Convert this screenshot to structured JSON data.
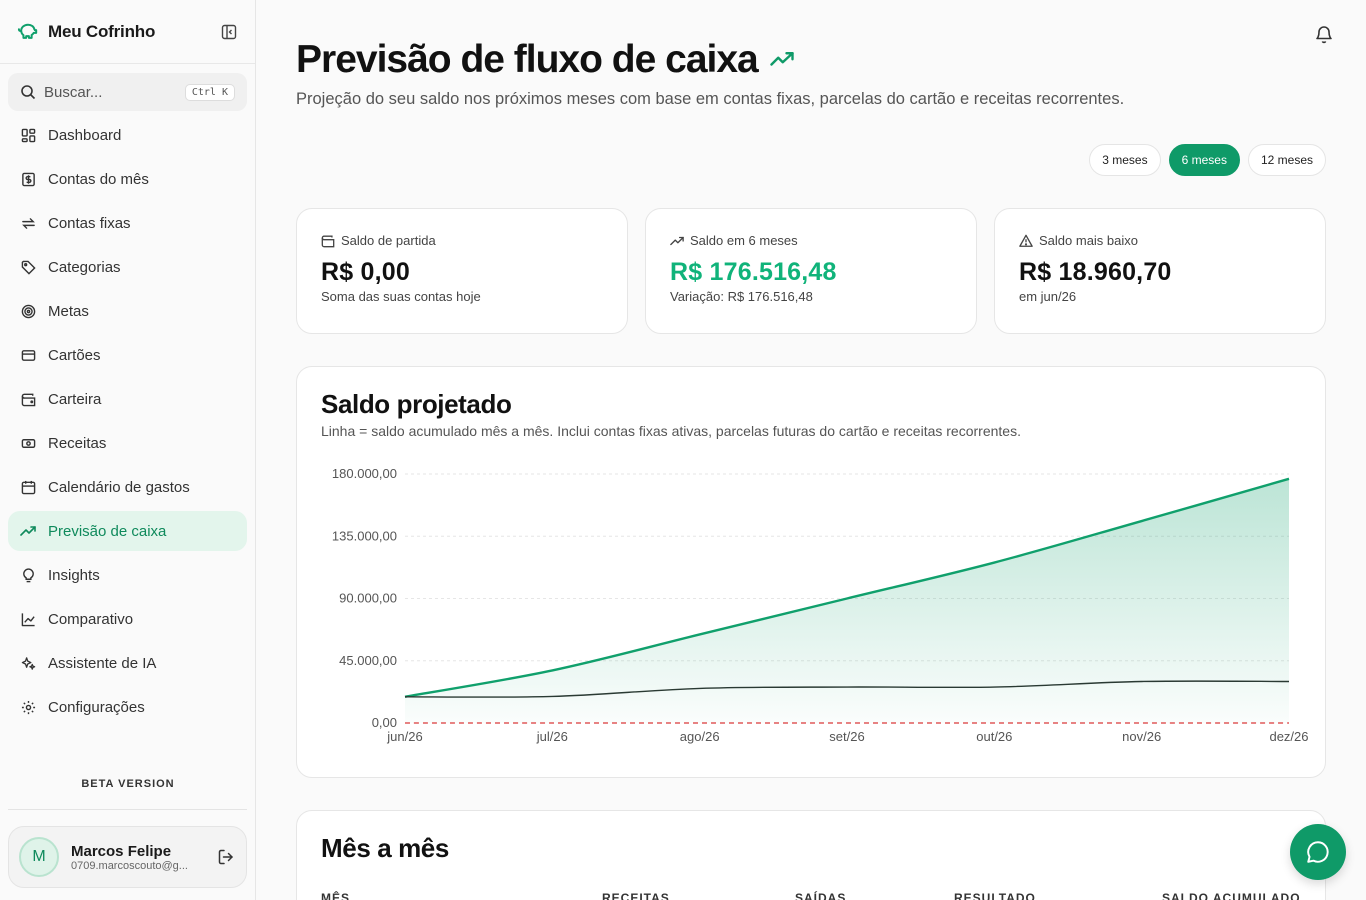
{
  "sidebar": {
    "brand": "Meu Cofrinho",
    "search_label": "Buscar...",
    "search_shortcut": "Ctrl K",
    "items": [
      {
        "label": "Dashboard",
        "icon": "dashboard-icon"
      },
      {
        "label": "Contas do mês",
        "icon": "receipt-icon"
      },
      {
        "label": "Contas fixas",
        "icon": "repeat-icon"
      },
      {
        "label": "Categorias",
        "icon": "tag-icon"
      },
      {
        "label": "Metas",
        "icon": "target-icon"
      },
      {
        "label": "Cartões",
        "icon": "credit-card-icon"
      },
      {
        "label": "Carteira",
        "icon": "wallet-icon"
      },
      {
        "label": "Receitas",
        "icon": "banknote-icon"
      },
      {
        "label": "Calendário de gastos",
        "icon": "calendar-icon"
      },
      {
        "label": "Previsão de caixa",
        "icon": "trending-up-icon",
        "active": true
      },
      {
        "label": "Insights",
        "icon": "lightbulb-icon"
      },
      {
        "label": "Comparativo",
        "icon": "line-chart-icon"
      },
      {
        "label": "Assistente de IA",
        "icon": "sparkles-icon"
      },
      {
        "label": "Configurações",
        "icon": "gear-icon"
      }
    ],
    "beta_label": "BETA VERSION",
    "user": {
      "initial": "M",
      "name": "Marcos Felipe",
      "email": "0709.marcoscouto@g..."
    }
  },
  "header": {
    "title": "Previsão de fluxo de caixa",
    "subtitle": "Projeção do seu saldo nos próximos meses com base em contas fixas, parcelas do cartão e receitas recorrentes."
  },
  "ranges": [
    {
      "label": "3 meses",
      "active": false
    },
    {
      "label": "6 meses",
      "active": true
    },
    {
      "label": "12 meses",
      "active": false
    }
  ],
  "stats": {
    "start": {
      "label": "Saldo de partida",
      "value": "R$ 0,00",
      "note": "Soma das suas contas hoje"
    },
    "future": {
      "label": "Saldo em 6 meses",
      "value": "R$ 176.516,48",
      "note": "Variação: R$ 176.516,48"
    },
    "lowest": {
      "label": "Saldo mais baixo",
      "value": "R$ 18.960,70",
      "note": "em jun/26"
    }
  },
  "chart_section": {
    "title": "Saldo projetado",
    "description": "Linha = saldo acumulado mês a mês. Inclui contas fixas ativas, parcelas futuras do cartão e receitas recorrentes."
  },
  "chart_data": {
    "type": "area",
    "categories": [
      "jun/26",
      "jul/26",
      "ago/26",
      "set/26",
      "out/26",
      "nov/26",
      "dez/26"
    ],
    "series": [
      {
        "values": [
          18960.7,
          38000,
          64000,
          90000,
          116000,
          146000,
          176516.48
        ],
        "color": "#10a06c",
        "fill": true
      },
      {
        "values": [
          18960.7,
          19200,
          25000,
          26000,
          26000,
          30000,
          30000
        ],
        "color": "#2a3a33",
        "fill": false
      },
      {
        "values": [
          0,
          0,
          0,
          0,
          0,
          0,
          0
        ],
        "color": "#e05a5a",
        "dashed": true
      }
    ],
    "y_ticks": [
      "180.000,00",
      "135.000,00",
      "90.000,00",
      "45.000,00",
      "0,00"
    ],
    "y_tick_values": [
      180000,
      135000,
      90000,
      45000,
      0
    ],
    "ylim": [
      0,
      180000
    ],
    "grid": true
  },
  "month_section": {
    "title": "Mês a mês",
    "columns": [
      "MÊS",
      "RECEITAS",
      "SAÍDAS",
      "RESULTADO",
      "SALDO ACUMULADO"
    ]
  },
  "colors": {
    "accent": "#0f9a68",
    "accent_light": "#e3f5ec",
    "positive": "#10b37a"
  }
}
